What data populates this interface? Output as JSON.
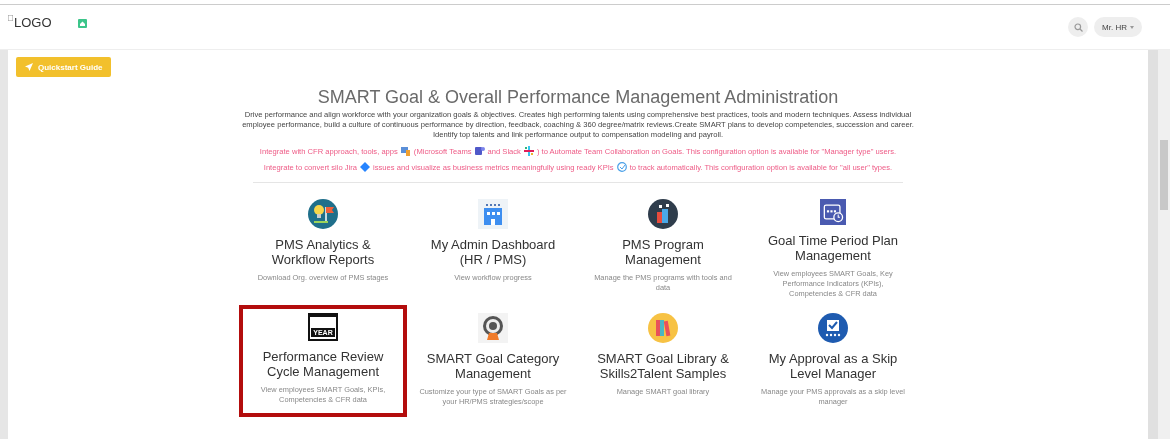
{
  "header": {
    "logo_alt": "LOGO",
    "user_menu": "Mr. HR"
  },
  "quickstart": {
    "label": "Quickstart Guide"
  },
  "intro": {
    "title": "SMART Goal & Overall Performance Management Administration",
    "description": "Drive performance and align workforce with your organization goals & objectives. Creates high performing talents using comprehensive best practices, tools and modern techniques. Assess individual employee performance, build a culture of continuous performance by direction, feedback, coaching & 360 degree/matrix reviews.Create SMART plans to develop competencies, succession and career. Identify top talents and link performance output to compensation modeling and payroll.",
    "notes": [
      {
        "parts": [
          "Integrate with CFR approach, tools, apps",
          "(Microsoft Teams",
          "and Slack",
          ") to Automate Team Collaboration on Goals. This configuration option is available for \"Manager type\" users."
        ]
      },
      {
        "parts": [
          "Integrate to convert silo Jira",
          "issues and visualize as business metrics meaningfully using ready KPIs",
          "to track automatically. This configuration option is available for \"all user\" types."
        ]
      }
    ]
  },
  "cards": [
    {
      "title": "PMS Analytics & Workflow Reports",
      "subtitle": "Download Org. overview of PMS stages",
      "highlighted": false
    },
    {
      "title": "My Admin Dashboard (HR / PMS)",
      "subtitle": "View workflow progress",
      "highlighted": false
    },
    {
      "title": "PMS Program Management",
      "subtitle": "Manage the PMS programs with tools and data",
      "highlighted": false
    },
    {
      "title": "Goal Time Period Plan Management",
      "subtitle": "View employees SMART Goals, Key Performance Indicators (KPIs), Competencies & CFR data",
      "highlighted": false
    },
    {
      "title": "Performance Review Cycle Management",
      "subtitle": "View employees SMART Goals, KPIs, Competencies & CFR data",
      "highlighted": true,
      "icon_text": "YEAR"
    },
    {
      "title": "SMART Goal Category Management",
      "subtitle": "Customize your type of SMART Goals as per your HR/PMS strategies/scope",
      "highlighted": false
    },
    {
      "title": "SMART Goal Library & Skills2Talent Samples",
      "subtitle": "Manage SMART goal library",
      "highlighted": false
    },
    {
      "title": "My Approval as a Skip Level Manager",
      "subtitle": "Manage your PMS approvals as a skip level manager",
      "highlighted": false
    }
  ]
}
